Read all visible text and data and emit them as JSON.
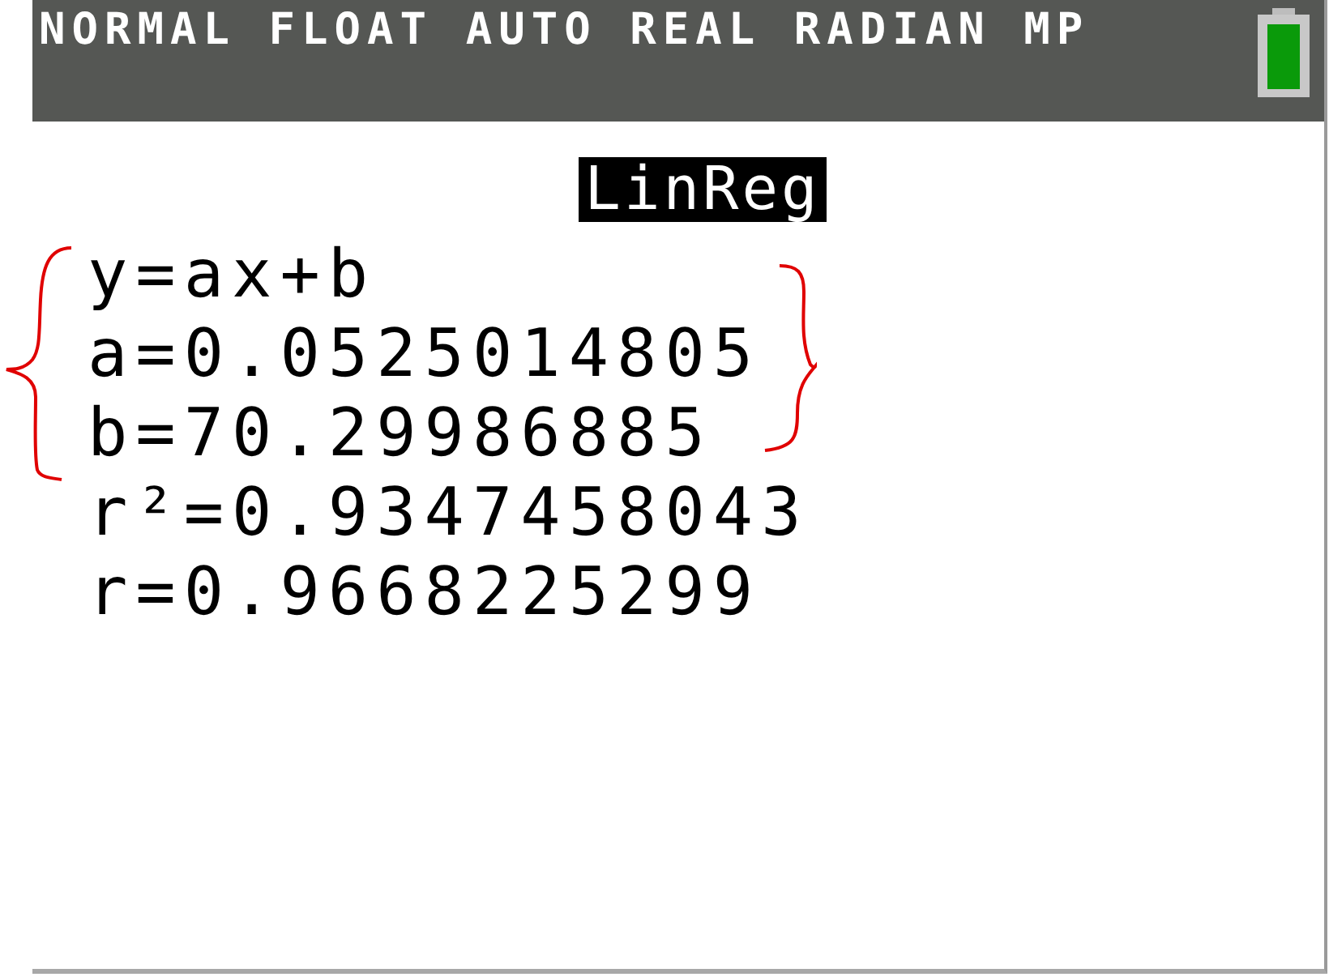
{
  "status_bar": {
    "modes": "NORMAL FLOAT AUTO REAL RADIAN MP"
  },
  "title": "LinReg",
  "lines": [
    "y=ax+b",
    "a=0.0525014805",
    "b=70.29986885",
    "r²=0.9347458043",
    "r=0.9668225299"
  ]
}
